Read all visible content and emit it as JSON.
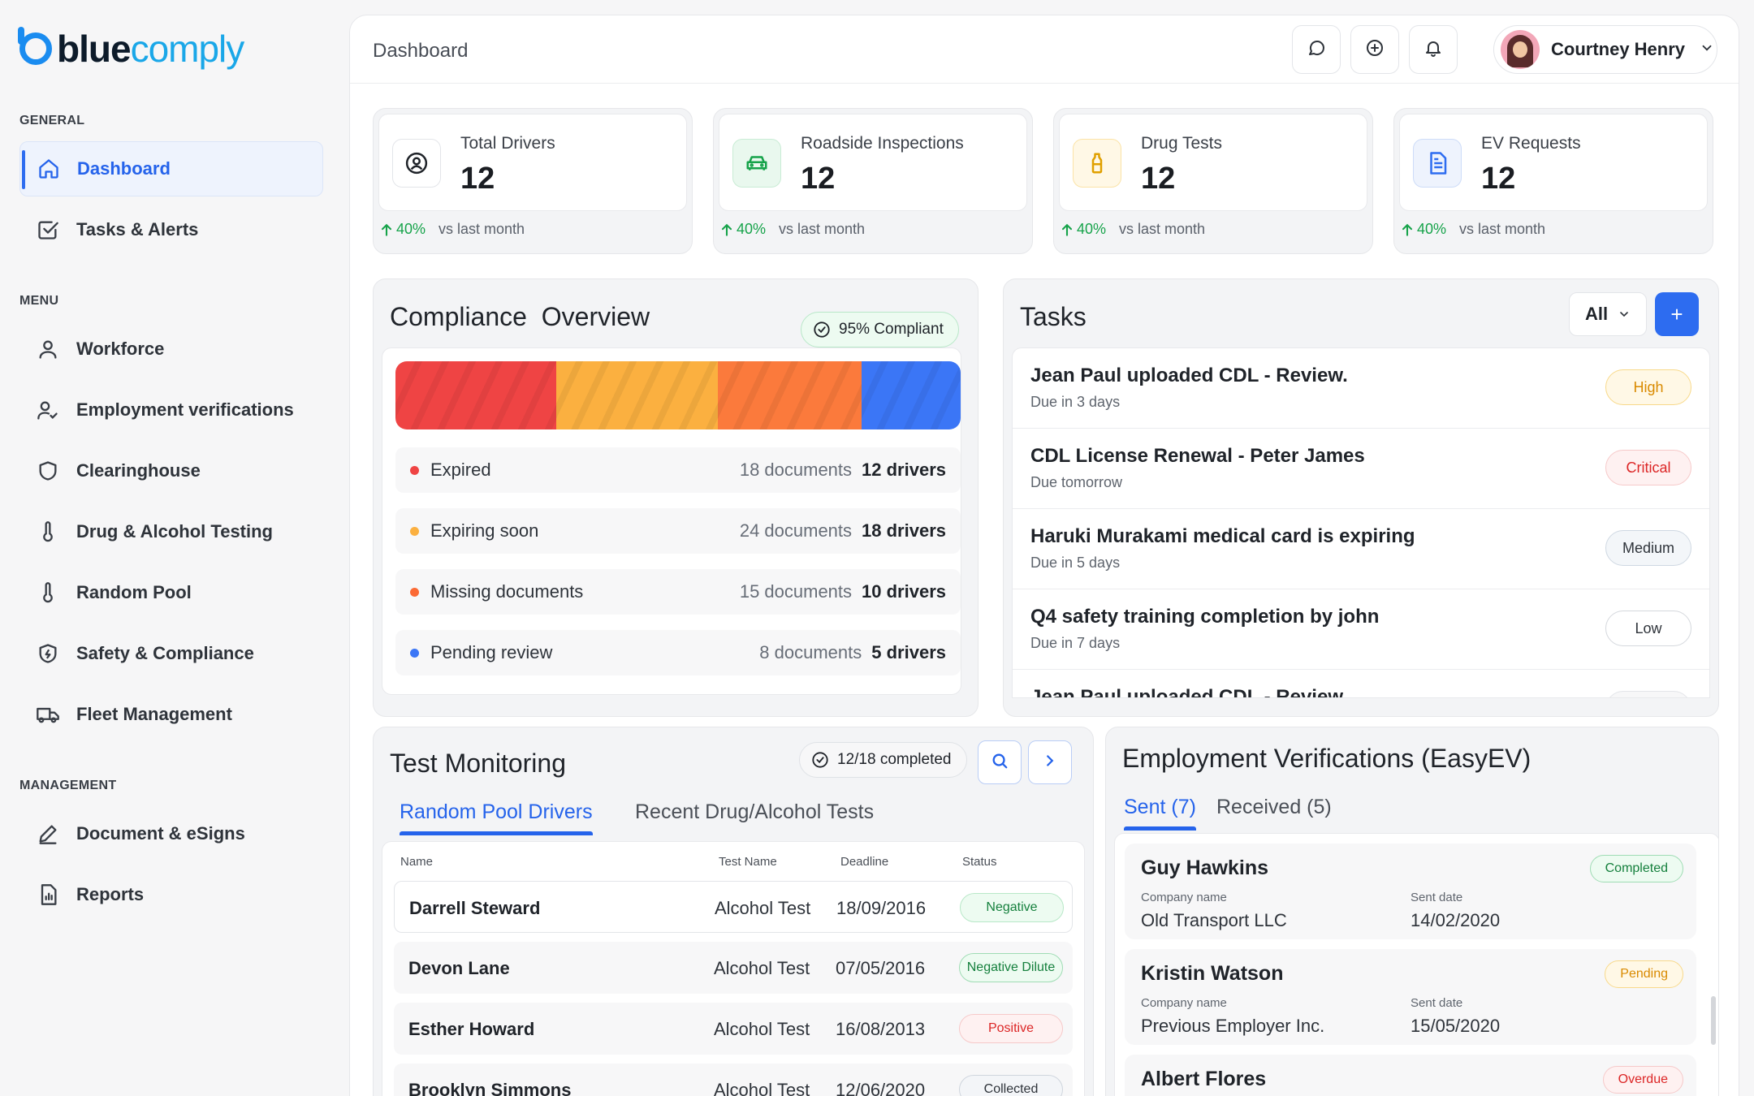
{
  "logo": {
    "part1": "blue",
    "part2": "comply"
  },
  "sidebar": {
    "general_label": "GENERAL",
    "general": [
      {
        "label": "Dashboard",
        "icon": "home-icon",
        "active": true
      },
      {
        "label": "Tasks & Alerts",
        "icon": "checkbox-icon"
      }
    ],
    "menu_label": "MENU",
    "menu": [
      {
        "label": "Workforce",
        "icon": "user-icon"
      },
      {
        "label": "Employment verifications",
        "icon": "user-check-icon"
      },
      {
        "label": "Clearinghouse",
        "icon": "shield-icon"
      },
      {
        "label": "Drug & Alcohol Testing",
        "icon": "thermometer-icon"
      },
      {
        "label": "Random Pool",
        "icon": "thermometer-icon"
      },
      {
        "label": "Safety & Compliance",
        "icon": "shield-bolt-icon"
      },
      {
        "label": "Fleet Management",
        "icon": "truck-icon"
      }
    ],
    "management_label": "MANAGEMENT",
    "management": [
      {
        "label": "Document & eSigns",
        "icon": "pen-icon"
      },
      {
        "label": "Reports",
        "icon": "report-icon"
      }
    ]
  },
  "header": {
    "title": "Dashboard",
    "user_name": "Courtney Henry"
  },
  "stats": [
    {
      "title": "Total Drivers",
      "value": "12",
      "change": "40%",
      "vs": "vs last month",
      "icon": "user-circle-icon"
    },
    {
      "title": "Roadside Inspections",
      "value": "12",
      "change": "40%",
      "vs": "vs last month",
      "icon": "car-icon"
    },
    {
      "title": "Drug Tests",
      "value": "12",
      "change": "40%",
      "vs": "vs last month",
      "icon": "bottle-icon"
    },
    {
      "title": "EV Requests",
      "value": "12",
      "change": "40%",
      "vs": "vs last month",
      "icon": "document-icon"
    }
  ],
  "compliance": {
    "title": "Compliance  Overview",
    "badge": "95% Compliant",
    "segments": [
      {
        "name": "Expired",
        "share": 0.285,
        "color": "#ef4444"
      },
      {
        "name": "Expiring soon",
        "share": 0.285,
        "color": "#fbb040"
      },
      {
        "name": "Missing documents",
        "share": 0.255,
        "color": "#fb7a3c"
      },
      {
        "name": "Pending review",
        "share": 0.175,
        "color": "#3b76f6"
      }
    ],
    "rows": [
      {
        "label": "Expired",
        "docs": "18 documents",
        "drivers": "12 drivers",
        "color": "#ef4444"
      },
      {
        "label": "Expiring soon",
        "docs": "24 documents",
        "drivers": "18 drivers",
        "color": "#fbb040"
      },
      {
        "label": "Missing documents",
        "docs": "15 documents",
        "drivers": "10 drivers",
        "color": "#fb6a35"
      },
      {
        "label": "Pending review",
        "docs": "8 documents",
        "drivers": "5 drivers",
        "color": "#3b76f6"
      }
    ]
  },
  "tasks": {
    "title": "Tasks",
    "filter": "All",
    "add_label": "+",
    "items": [
      {
        "title": "Jean Paul uploaded CDL - Review.",
        "due": "Due in 3 days",
        "priority": "High"
      },
      {
        "title": "CDL License Renewal - Peter James",
        "due": "Due tomorrow",
        "priority": "Critical"
      },
      {
        "title": "Haruki Murakami medical card is expiring",
        "due": "Due in 5 days",
        "priority": "Medium"
      },
      {
        "title": "Q4 safety training completion by john",
        "due": "Due in 7 days",
        "priority": "Low"
      },
      {
        "title": "Jean Paul uploaded CDL - Review.",
        "due": "",
        "priority": ""
      }
    ]
  },
  "test_monitoring": {
    "title": "Test Monitoring",
    "badge": "12/18 completed",
    "tabs": [
      "Random Pool Drivers",
      "Recent Drug/Alcohol Tests"
    ],
    "columns": [
      "Name",
      "Test Name",
      "Deadline",
      "Status"
    ],
    "rows": [
      {
        "name": "Darrell Steward",
        "test": "Alcohol Test",
        "deadline": "18/09/2016",
        "status": "Negative"
      },
      {
        "name": "Devon Lane",
        "test": "Alcohol Test",
        "deadline": "07/05/2016",
        "status": "Negative Dilute"
      },
      {
        "name": "Esther Howard",
        "test": "Alcohol Test",
        "deadline": "16/08/2013",
        "status": "Positive"
      },
      {
        "name": "Brooklyn Simmons",
        "test": "Alcohol Test",
        "deadline": "12/06/2020",
        "status": "Collected"
      }
    ]
  },
  "employment": {
    "title": "Employment Verifications (EasyEV)",
    "tabs": [
      "Sent (7)",
      "Received (5)"
    ],
    "company_label": "Company name",
    "sent_label": "Sent date",
    "items": [
      {
        "name": "Guy Hawkins",
        "company": "Old Transport LLC",
        "date": "14/02/2020",
        "status": "Completed"
      },
      {
        "name": "Kristin Watson",
        "company": "Previous Employer Inc.",
        "date": "15/05/2020",
        "status": "Pending"
      },
      {
        "name": "Albert Flores",
        "company": "",
        "date": "",
        "status": "Overdue"
      }
    ]
  },
  "colors": {
    "accent": "#2563eb",
    "positive": "#16a34a",
    "brand_blue": "#1a8cf0",
    "brand_cyan": "#1aa7e8"
  }
}
